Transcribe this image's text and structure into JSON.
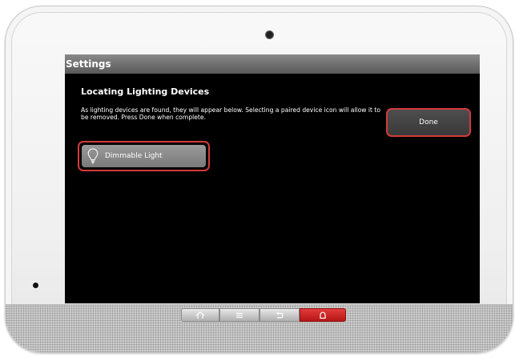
{
  "screen": {
    "title": "Settings",
    "heading": "Locating Lighting Devices",
    "description": "As lighting devices are found, they will appear below.  Selecting a paired device icon will allow it to be removed.  Press Done when complete.",
    "done_label": "Done",
    "devices": [
      {
        "label": "Dimmable Light",
        "icon": "lightbulb-icon"
      }
    ]
  },
  "navbar": {
    "buttons": [
      {
        "icon": "home-icon"
      },
      {
        "icon": "menu-icon"
      },
      {
        "icon": "back-icon"
      },
      {
        "icon": "alarm-icon",
        "color": "#c41e1e"
      }
    ]
  },
  "colors": {
    "highlight_border": "#d43a3a",
    "screen_background": "#000000",
    "titlebar": "#6e6e6e"
  }
}
